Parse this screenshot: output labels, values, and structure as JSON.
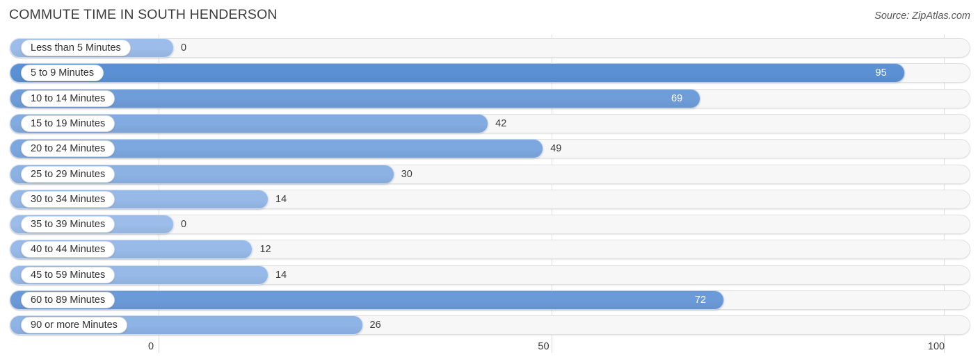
{
  "header": {
    "title": "COMMUTE TIME IN SOUTH HENDERSON",
    "source": "Source: ZipAtlas.com"
  },
  "axis": {
    "ticks": [
      "0",
      "50",
      "100"
    ]
  },
  "colors": {
    "bar_high": "#5b91d4",
    "bar_mid": "#6f9dd9",
    "bar_low": "#8fb4e6",
    "track": "#f7f7f7",
    "track_border": "#e0e0e0",
    "gridline": "#e3e3e3",
    "title_text": "#3c3c3c",
    "label_text": "#2f2f2f",
    "value_text_outside": "#3a3a3a",
    "value_text_inside": "#ffffff"
  },
  "chart_data": {
    "type": "bar",
    "orientation": "horizontal",
    "title": "COMMUTE TIME IN SOUTH HENDERSON",
    "subtitle": "",
    "xlabel": "",
    "ylabel": "",
    "xlim": [
      0,
      100
    ],
    "xticks": [
      0,
      50,
      100
    ],
    "grid": true,
    "legend": null,
    "categories": [
      "Less than 5 Minutes",
      "5 to 9 Minutes",
      "10 to 14 Minutes",
      "15 to 19 Minutes",
      "20 to 24 Minutes",
      "25 to 29 Minutes",
      "30 to 34 Minutes",
      "35 to 39 Minutes",
      "40 to 44 Minutes",
      "45 to 59 Minutes",
      "60 to 89 Minutes",
      "90 or more Minutes"
    ],
    "values": [
      0,
      95,
      69,
      42,
      49,
      30,
      14,
      0,
      12,
      14,
      72,
      26
    ],
    "value_labels": [
      "0",
      "95",
      "69",
      "42",
      "49",
      "30",
      "14",
      "0",
      "12",
      "14",
      "72",
      "26"
    ]
  },
  "rows": [
    {
      "label": "Less than 5 Minutes",
      "value": 0,
      "value_label": "0",
      "inside": false,
      "color": "#9cbce9"
    },
    {
      "label": "5 to 9 Minutes",
      "value": 95,
      "value_label": "95",
      "inside": true,
      "color": "#5b91d4"
    },
    {
      "label": "10 to 14 Minutes",
      "value": 69,
      "value_label": "69",
      "inside": true,
      "color": "#6f9dd9"
    },
    {
      "label": "15 to 19 Minutes",
      "value": 42,
      "value_label": "42",
      "inside": false,
      "color": "#82abe1"
    },
    {
      "label": "20 to 24 Minutes",
      "value": 49,
      "value_label": "49",
      "inside": false,
      "color": "#7ca7df"
    },
    {
      "label": "25 to 29 Minutes",
      "value": 30,
      "value_label": "30",
      "inside": false,
      "color": "#8cb2e4"
    },
    {
      "label": "30 to 34 Minutes",
      "value": 14,
      "value_label": "14",
      "inside": false,
      "color": "#97b9e7"
    },
    {
      "label": "35 to 39 Minutes",
      "value": 0,
      "value_label": "0",
      "inside": false,
      "color": "#9cbce9"
    },
    {
      "label": "40 to 44 Minutes",
      "value": 12,
      "value_label": "12",
      "inside": false,
      "color": "#98bae8"
    },
    {
      "label": "45 to 59 Minutes",
      "value": 14,
      "value_label": "14",
      "inside": false,
      "color": "#97b9e7"
    },
    {
      "label": "60 to 89 Minutes",
      "value": 72,
      "value_label": "72",
      "inside": true,
      "color": "#6b9ad8"
    },
    {
      "label": "90 or more Minutes",
      "value": 26,
      "value_label": "26",
      "inside": false,
      "color": "#8eb3e5"
    }
  ]
}
